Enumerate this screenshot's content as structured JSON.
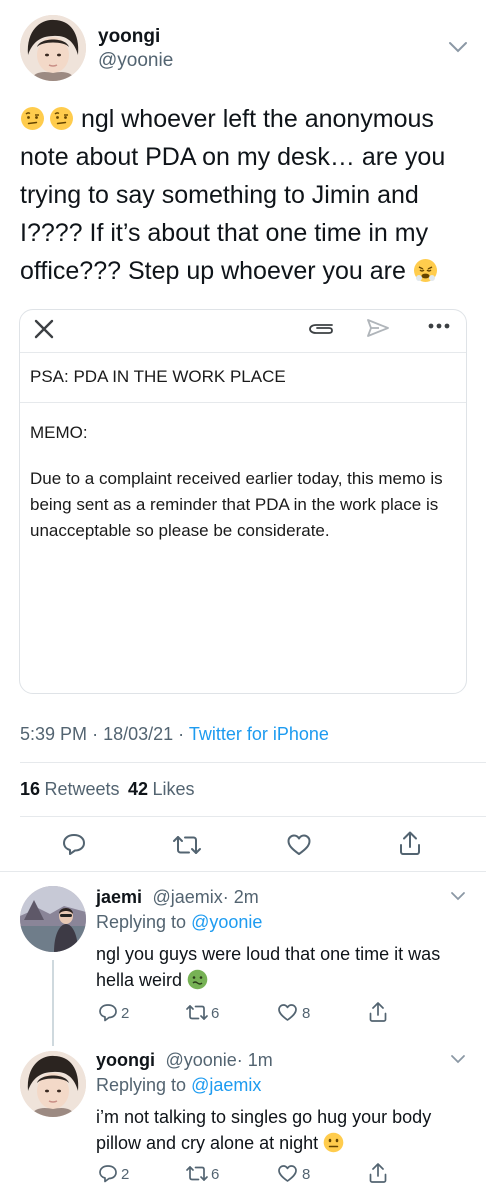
{
  "tweet": {
    "author": {
      "name": "yoongi",
      "handle": "@yoonie"
    },
    "text_after_emoji": " ngl whoever left the anonymous note about PDA on my desk… are you trying to say something to Jimin and I???? If it’s about that one time in my office??? Step up whoever you are ",
    "leading_emoji": "face-with-raised-eyebrow",
    "trailing_emoji": "face-with-steam-from-nose",
    "attachment": {
      "subject": "PSA: PDA IN THE WORK PLACE",
      "body_heading": "MEMO:",
      "body_text": "Due to a complaint received earlier today, this memo is being sent as a reminder that PDA in the work place is unacceptable so please be considerate.",
      "toolbar_icons": [
        "close-icon",
        "paperclip-icon",
        "send-icon",
        "more-icon"
      ]
    },
    "time": "5:39 PM",
    "date": "18/03/21",
    "separator": "·",
    "client": "Twitter for iPhone",
    "stats": {
      "retweets_count": "16",
      "retweets_label": "Retweets",
      "likes_count": "42",
      "likes_label": "Likes"
    },
    "actions": [
      "reply-icon",
      "retweet-icon",
      "like-icon",
      "share-icon"
    ]
  },
  "replies": [
    {
      "name": "jaemi",
      "handle": "@jaemix",
      "time": "· 2m",
      "replying_prefix": "Replying to ",
      "replying_to": "@yoonie",
      "text": "ngl you guys were loud that one time it was hella weird ",
      "emoji": "nauseated-face",
      "reply_count": "2",
      "retweet_count": "6",
      "like_count": "8"
    },
    {
      "name": "yoongi",
      "handle": "@yoonie",
      "time": "· 1m",
      "replying_prefix": "Replying to ",
      "replying_to": "@jaemix",
      "text": "i’m not talking to singles go hug your body pillow and cry alone at night ",
      "emoji": "neutral-face",
      "reply_count": "2",
      "retweet_count": "6",
      "like_count": "8"
    }
  ],
  "colors": {
    "link": "#1d9bf0",
    "secondary_text": "#536471",
    "primary_text": "#0f1419",
    "border": "#dfe3e7"
  }
}
